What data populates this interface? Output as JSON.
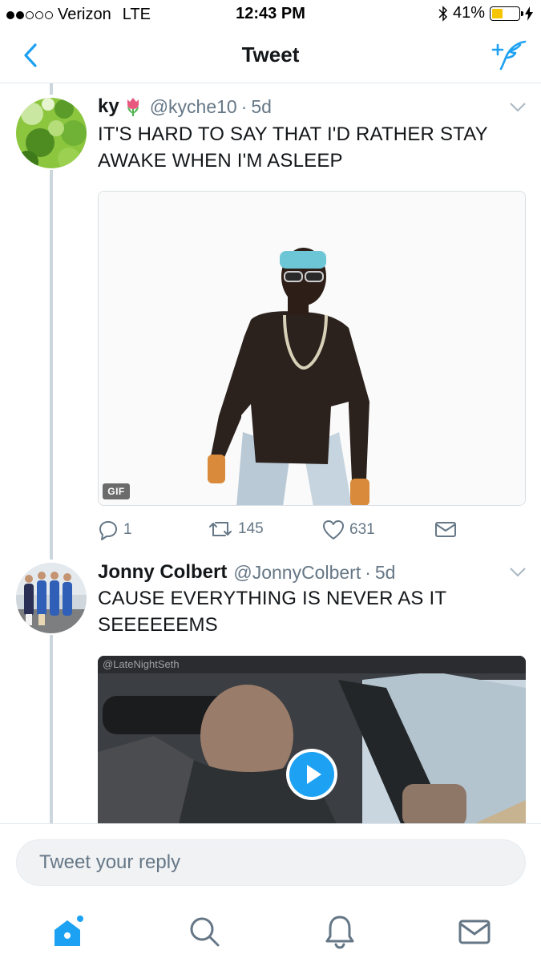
{
  "status_bar": {
    "carrier": "Verizon",
    "network": "LTE",
    "time": "12:43 PM",
    "battery_percent": "41%",
    "battery_level": 0.41,
    "signal_bars_filled": 2,
    "signal_bars_total": 5
  },
  "nav": {
    "title": "Tweet",
    "accent_color": "#1da1f2"
  },
  "tweets": [
    {
      "name": "ky",
      "name_emoji": "tulip-emoji",
      "handle": "@kyche10",
      "time_ago": "5d",
      "text": "IT'S HARD TO SAY THAT I'D RATHER STAY AWAKE WHEN I'M ASLEEP",
      "media_badge": "GIF",
      "replies": "1",
      "retweets": "145",
      "likes": "631"
    },
    {
      "name": "Jonny Colbert",
      "handle": "@JonnyColbert",
      "time_ago": "5d",
      "text": "CAUSE EVERYTHING IS NEVER AS IT SEEEEEEMS",
      "media_watermark": "@LateNightSeth"
    }
  ],
  "reply": {
    "placeholder": "Tweet your reply"
  },
  "tabs": [
    "home-icon",
    "search-icon",
    "notifications-icon",
    "messages-icon"
  ]
}
